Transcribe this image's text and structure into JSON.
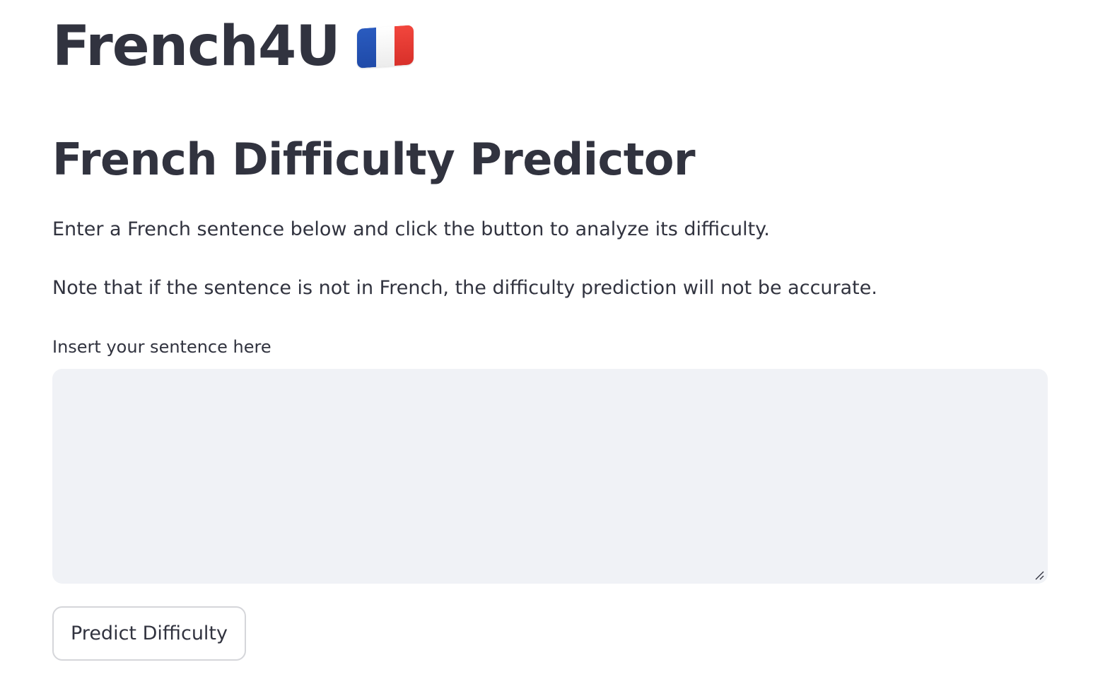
{
  "header": {
    "app_title": "French4U",
    "flag_icon": "france-flag-icon"
  },
  "main": {
    "section_title": "French Difficulty Predictor",
    "intro_text": "Enter a French sentence below and click the button to analyze its difficulty.",
    "note_text": "Note that if the sentence is not in French, the difficulty prediction will not be accurate.",
    "input": {
      "label": "Insert your sentence here",
      "value": "",
      "placeholder": "",
      "background_color": "#f0f2f6"
    },
    "predict_button_label": "Predict Difficulty"
  },
  "colors": {
    "text": "#31333f",
    "flag_blue": "#1f4aa8",
    "flag_white": "#ffffff",
    "flag_red": "#e03a32"
  }
}
